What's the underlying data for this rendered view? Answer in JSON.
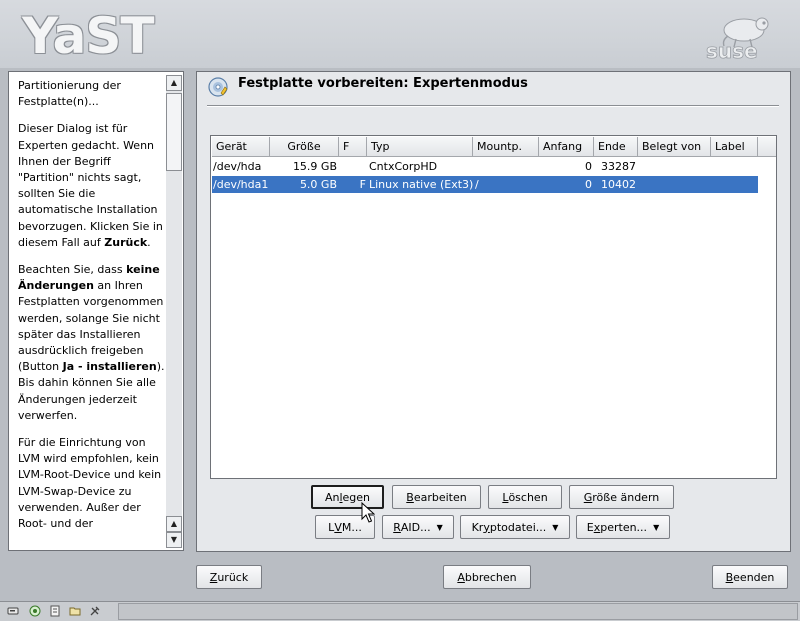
{
  "header": {
    "logo_text": "YaST",
    "brand_logo": "suse"
  },
  "help": {
    "paragraphs": [
      "Partitionierung der Festplatte(n)...",
      "Dieser Dialog ist für Experten gedacht. Wenn Ihnen der Begriff \"Partition\" nichts sagt, sollten Sie die automatische Installation bevorzugen. Klicken Sie in diesem Fall auf Zurück.",
      "Beachten Sie, dass keine Änderungen an Ihren Festplatten vorgenommen werden, solange Sie nicht später das Installieren ausdrücklich freigeben (Button Ja - installieren). Bis dahin können Sie alle Änderungen jederzeit verwerfen.",
      "Für die Einrichtung von LVM wird empfohlen, kein LVM-Root-Device und kein LVM-Swap-Device zu verwenden. Außer der Root- und der"
    ],
    "p2_before": "Dieser Dialog ist für Experten gedacht. Wenn Ihnen der Begriff \"Partition\" nichts sagt, sollten Sie die automatische Installation bevorzugen. Klicken Sie in diesem Fall auf ",
    "p2_bold": "Zurück",
    "p2_after": ".",
    "p3_a": "Beachten Sie, dass ",
    "p3_bold1": "keine Änderungen",
    "p3_b": " an Ihren Festplatten vorgenommen werden, solange Sie nicht später das Installieren ausdrücklich freigeben (Button ",
    "p3_bold2": "Ja - installieren",
    "p3_c": "). Bis dahin können Sie alle Änderungen jederzeit verwerfen.",
    "p1": "Partitionierung der Festplatte(n)...",
    "p4": "Für die Einrichtung von LVM wird empfohlen, kein LVM-Root-Device und kein LVM-Swap-Device zu verwenden. Außer der Root- und der"
  },
  "main": {
    "title": "Festplatte vorbereiten: Expertenmodus",
    "title_icon": "disk-icon"
  },
  "table": {
    "columns": [
      "Gerät",
      "Größe",
      "F",
      "Typ",
      "Mountp.",
      "Anfang",
      "Ende",
      "Belegt von",
      "Label"
    ],
    "rows": [
      {
        "device": "/dev/hda",
        "size": "15.9 GB",
        "f": "",
        "type": "CntxCorpHD",
        "mount": "",
        "start": "0",
        "end": "33287",
        "used_by": "",
        "label": "",
        "selected": false
      },
      {
        "device": "/dev/hda1",
        "size": "5.0 GB",
        "f": "F",
        "type": "Linux native (Ext3)",
        "mount": "/",
        "start": "0",
        "end": "10402",
        "used_by": "",
        "label": "",
        "selected": true
      }
    ]
  },
  "buttons": {
    "create": {
      "pre": "An",
      "mn": "l",
      "post": "egen"
    },
    "edit": {
      "pre": "",
      "mn": "B",
      "post": "earbeiten"
    },
    "delete": {
      "pre": "",
      "mn": "L",
      "post": "öschen"
    },
    "resize": {
      "pre": "",
      "mn": "G",
      "post": "röße ändern"
    },
    "lvm": {
      "pre": "L",
      "mn": "V",
      "post": "M..."
    },
    "raid": {
      "pre": "",
      "mn": "R",
      "post": "AID..."
    },
    "crypto": {
      "pre": "Kr",
      "mn": "y",
      "post": "ptodatei..."
    },
    "expert": {
      "pre": "E",
      "mn": "x",
      "post": "perten..."
    },
    "back": {
      "pre": "",
      "mn": "Z",
      "post": "urück"
    },
    "abort": {
      "pre": "",
      "mn": "A",
      "post": "bbrechen"
    },
    "finish": {
      "pre": "",
      "mn": "B",
      "post": "eenden"
    }
  },
  "colors": {
    "selection": "#3a74c3",
    "background": "#b9bdc3",
    "panel": "#e6e8eb"
  }
}
